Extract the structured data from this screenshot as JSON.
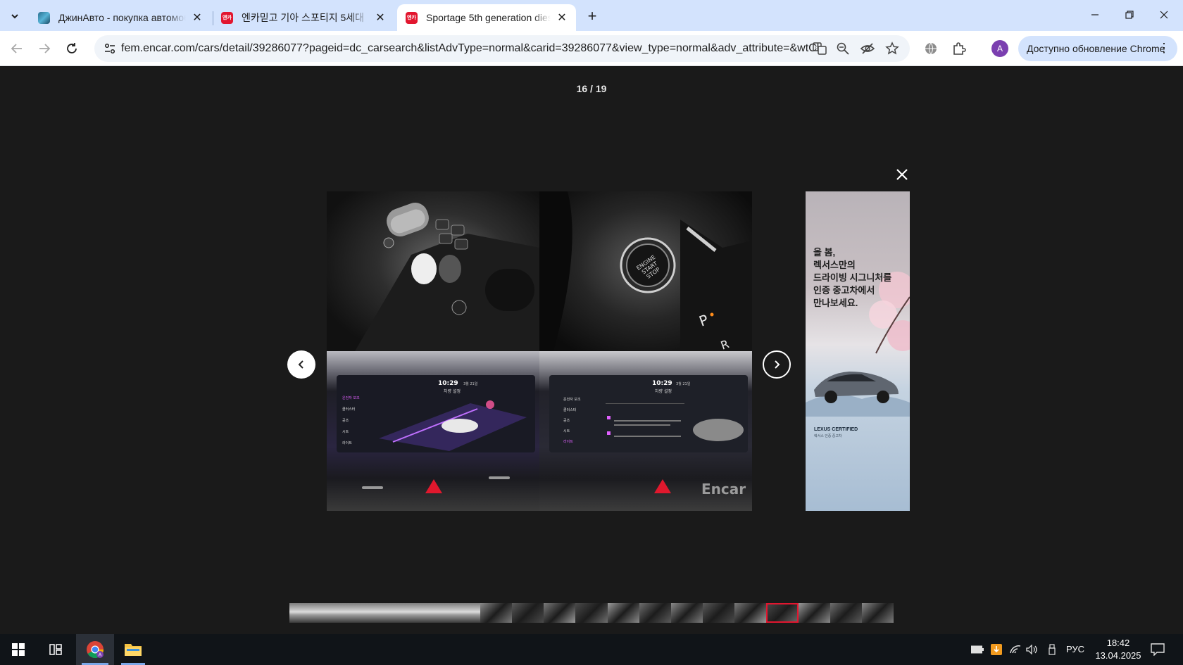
{
  "browser": {
    "tabs": [
      {
        "title": "ДжинАвто - покупка автомобиля",
        "favicon": "jinauto-favicon",
        "active": false
      },
      {
        "title": "엔카믿고 기아 스포티지 5세대",
        "favicon": "encar-favicon",
        "active": false
      },
      {
        "title": "Sportage 5th generation diesel",
        "favicon": "encar-favicon",
        "active": true
      }
    ],
    "favicon_text": "엔카",
    "url": "fem.encar.com/cars/detail/39286077?pageid=dc_carsearch&listAdvType=normal&carid=39286077&view_type=normal&adv_attribute=&wtCl...",
    "profile_initial": "A",
    "update_label": "Доступно обновление Chrome",
    "accent": "#d3e3fd"
  },
  "viewer": {
    "counter": "16 / 19",
    "watermark": "Encar",
    "photo_texts": {
      "start_stop": "ENGINE START STOP",
      "gear": "P",
      "gear2": "R",
      "screen_time_left": "10:29",
      "screen_time_right": "10:29",
      "screen_date": "3월 21일",
      "screen_title": "차량 설정",
      "menu_left": [
        "운전자 보조",
        "클러스터",
        "공조",
        "시트",
        "라이트"
      ],
      "menu_right": [
        "운전자 보조",
        "클러스터",
        "공조",
        "시트",
        "라이트"
      ]
    },
    "ad": {
      "lines": [
        "올 봄,",
        "렉서스만의",
        "드라이빙 시그니처를",
        "인증 중고차에서",
        "만나보세요."
      ],
      "brand": "LEXUS CERTIFIED",
      "sub": "렉서스 인증 중고차"
    },
    "thumbnail_count": 19,
    "current_thumbnail": 16
  },
  "taskbar": {
    "language": "РУС",
    "time": "18:42",
    "date": "13.04.2025"
  }
}
